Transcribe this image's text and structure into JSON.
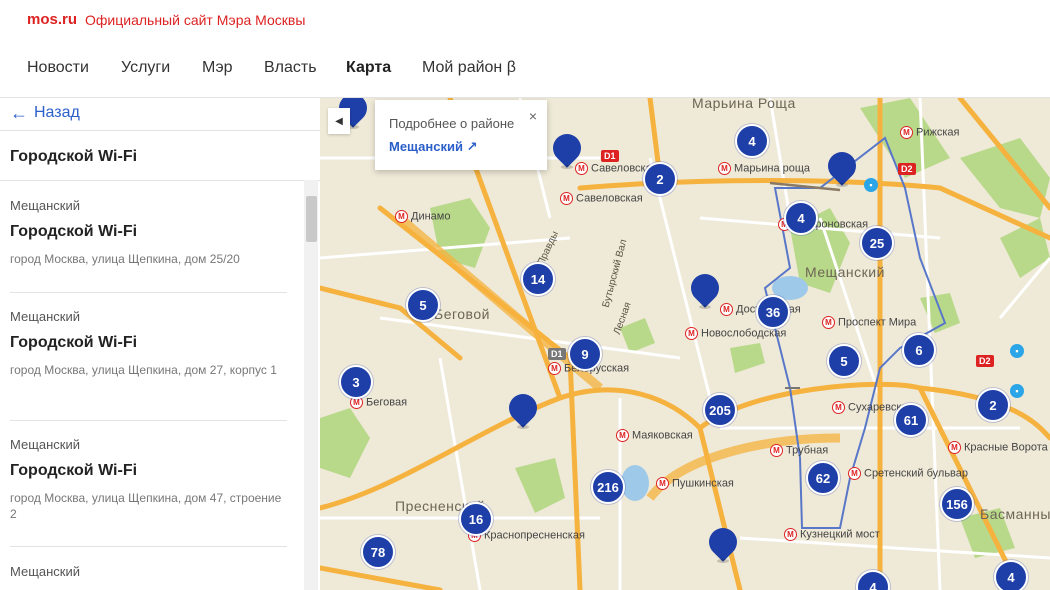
{
  "header": {
    "site": "mos.ru",
    "subtitle": "Официальный сайт Мэра Москвы"
  },
  "nav": {
    "items": [
      {
        "label": "Новости"
      },
      {
        "label": "Услуги"
      },
      {
        "label": "Мэр"
      },
      {
        "label": "Власть"
      },
      {
        "label": "Карта",
        "active": true
      },
      {
        "label": "Мой район β"
      }
    ]
  },
  "panel": {
    "back_label": "Назад",
    "title": "Городской Wi-Fi",
    "items": [
      {
        "district": "Мещанский",
        "name": "Городской Wi-Fi",
        "address": "город Москва, улица Щепкина, дом 25/20"
      },
      {
        "district": "Мещанский",
        "name": "Городской Wi-Fi",
        "address": "город Москва, улица Щепкина, дом 27, корпус 1"
      },
      {
        "district": "Мещанский",
        "name": "Городской Wi-Fi",
        "address": "город Москва, улица Щепкина, дом 47, строение 2"
      },
      {
        "district": "Мещанский",
        "name": "",
        "address": ""
      }
    ]
  },
  "popup": {
    "title": "Подробнее о районе",
    "link": "Мещанский",
    "close": "×"
  },
  "map": {
    "clusters": [
      "4",
      "2",
      "4",
      "25",
      "14",
      "5",
      "36",
      "9",
      "5",
      "6",
      "3",
      "205",
      "61",
      "2",
      "62",
      "216",
      "16",
      "156",
      "78",
      "4",
      "4"
    ],
    "districts": [
      "Марьина Роща",
      "Мещанский",
      "Беговой",
      "Пресненский",
      "Басманный"
    ],
    "metro": [
      "Рижская",
      "Марьина роща",
      "Савеловская",
      "Савеловская",
      "Динамо",
      "Трифоновская",
      "Достоевская",
      "Проспект Мира",
      "Новослободская",
      "Белорусская",
      "Беговая",
      "Сухаревская",
      "Красные Ворота",
      "Маяковская",
      "Трубная",
      "Сретенский бульвар",
      "Пушкинская",
      "Краснопресненская",
      "Кузнецкий мост"
    ],
    "streets": [
      "Правды",
      "Бутырский Вал",
      "Лесная",
      "Пресненский"
    ],
    "badges": [
      "D1",
      "D1",
      "D2",
      "D2"
    ],
    "colors": {
      "cluster": "#1e3fa8",
      "road_major": "#f5b23e",
      "boundary": "#5877c9",
      "park": "#b9d98a"
    }
  }
}
